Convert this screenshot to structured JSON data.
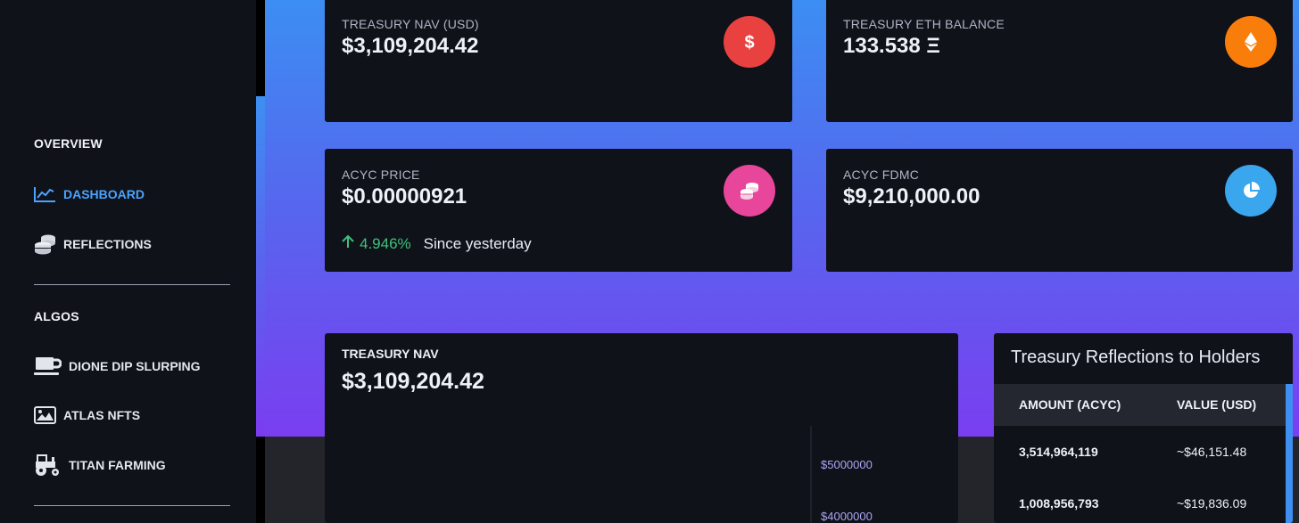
{
  "sidebar": {
    "overview_title": "OVERVIEW",
    "items_overview": [
      {
        "label": "DASHBOARD",
        "icon": "chart-line-icon"
      },
      {
        "label": "REFLECTIONS",
        "icon": "coins-icon"
      }
    ],
    "algos_title": "ALGOS",
    "items_algos": [
      {
        "label": "DIONE DIP SLURPING",
        "icon": "mug-icon"
      },
      {
        "label": "ATLAS NFTS",
        "icon": "image-icon"
      },
      {
        "label": "TITAN FARMING",
        "icon": "tractor-icon"
      }
    ]
  },
  "cards": {
    "treasury_nav": {
      "label": "TREASURY NAV (USD)",
      "value": "$3,109,204.42",
      "icon": "dollar-icon",
      "color": "#e8413f"
    },
    "eth_balance": {
      "label": "TREASURY ETH BALANCE",
      "value": "133.538 Ξ",
      "icon": "ethereum-icon",
      "color": "#f97d0b"
    },
    "acyc_price": {
      "label": "ACYC PRICE",
      "value": "$0.00000921",
      "change": "4.946%",
      "since": "Since yesterday",
      "icon": "coins-icon",
      "color": "#e8469a"
    },
    "acyc_fdmc": {
      "label": "ACYC FDMC",
      "value": "$9,210,000.00",
      "icon": "pie-chart-icon",
      "color": "#3aa6ee"
    }
  },
  "chart": {
    "label": "TREASURY NAV",
    "value": "$3,109,204.42"
  },
  "chart_data": {
    "type": "line",
    "title": "TREASURY NAV",
    "y_ticks": [
      "$5000000",
      "$4000000"
    ],
    "y_tick_values": [
      5000000,
      4000000
    ],
    "series": []
  },
  "reflections": {
    "title": "Treasury Reflections to Holders",
    "columns": [
      "AMOUNT (ACYC)",
      "VALUE (USD)"
    ],
    "rows": [
      [
        "3,514,964,119",
        "~$46,151.48"
      ],
      [
        "1,008,956,793",
        "~$19,836.09"
      ]
    ]
  }
}
